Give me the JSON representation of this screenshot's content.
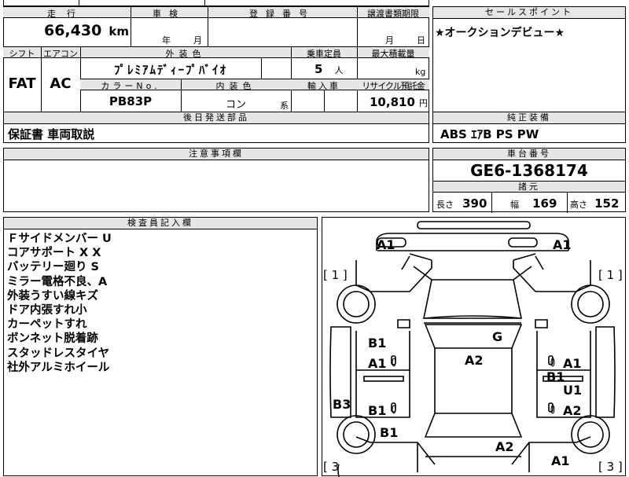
{
  "header": {
    "mileage_label": "走行",
    "mileage_value": "66,430",
    "mileage_unit": "km",
    "inspection_label": "車検",
    "year_label": "年",
    "month_label": "月",
    "plate_label": "登録番号",
    "transfer_label": "譲渡書類期限",
    "transfer_month_label": "月",
    "transfer_day_label": "日"
  },
  "sales_point": {
    "label": "セールスポイント",
    "text": "★オークションデビュー★"
  },
  "row2": {
    "shift_label": "シフト",
    "shift_value": "FAT",
    "ac_label": "エアコン",
    "ac_value": "AC",
    "exterior_color_label": "外装色",
    "exterior_color_value": "ﾌﾟﾚﾐｱﾑﾃﾞｨｰﾌﾟﾊﾞｲｵ",
    "capacity_label": "乗車定員",
    "capacity_value": "5",
    "capacity_unit": "人",
    "max_load_label": "最大積載量",
    "max_load_unit": "kg",
    "color_no_label": "カラーNo.",
    "color_no_value": "PB83P",
    "interior_color_label": "内装色",
    "interior_color_value": "コン",
    "interior_color_suffix": "系",
    "import_label": "輸入車",
    "recycle_label": "リサイクル預託金",
    "recycle_value": "10,810",
    "recycle_unit": "円"
  },
  "later_parts": {
    "label": "後日発送部品",
    "text": "保証書 車両取説"
  },
  "equipment": {
    "label": "純正装備",
    "text": "ABS ｴｱB PS PW"
  },
  "notes": {
    "label": "注意事項欄"
  },
  "chassis": {
    "label": "車台番号",
    "value": "GE6-1368174"
  },
  "dimensions": {
    "label": "諸元",
    "length_label": "長さ",
    "length_value": "390",
    "width_label": "幅",
    "width_value": "169",
    "height_label": "高さ",
    "height_value": "152"
  },
  "inspector": {
    "label": "検査員記入欄",
    "lines": [
      "Ｆサイドメンバー U",
      "コアサポート X X",
      "バッテリー廻り S",
      "ミラー電格不良、A",
      "外装うすい線キズ",
      "ドア内張すれ小",
      "カーペットすれ",
      "ボンネット脱着跡",
      "スタッドレスタイヤ",
      "社外アルミホイール"
    ]
  },
  "diagram": {
    "marks": [
      "A1",
      "A1",
      "[ 1 ]",
      "[ 1 ]",
      "B1",
      "A1",
      "G",
      "A2",
      "B1",
      "A1",
      "B3",
      "B1",
      "B1",
      "A1",
      "U1",
      "A2",
      "A2",
      "A1",
      "[ 3",
      "[ 3 ]"
    ]
  }
}
